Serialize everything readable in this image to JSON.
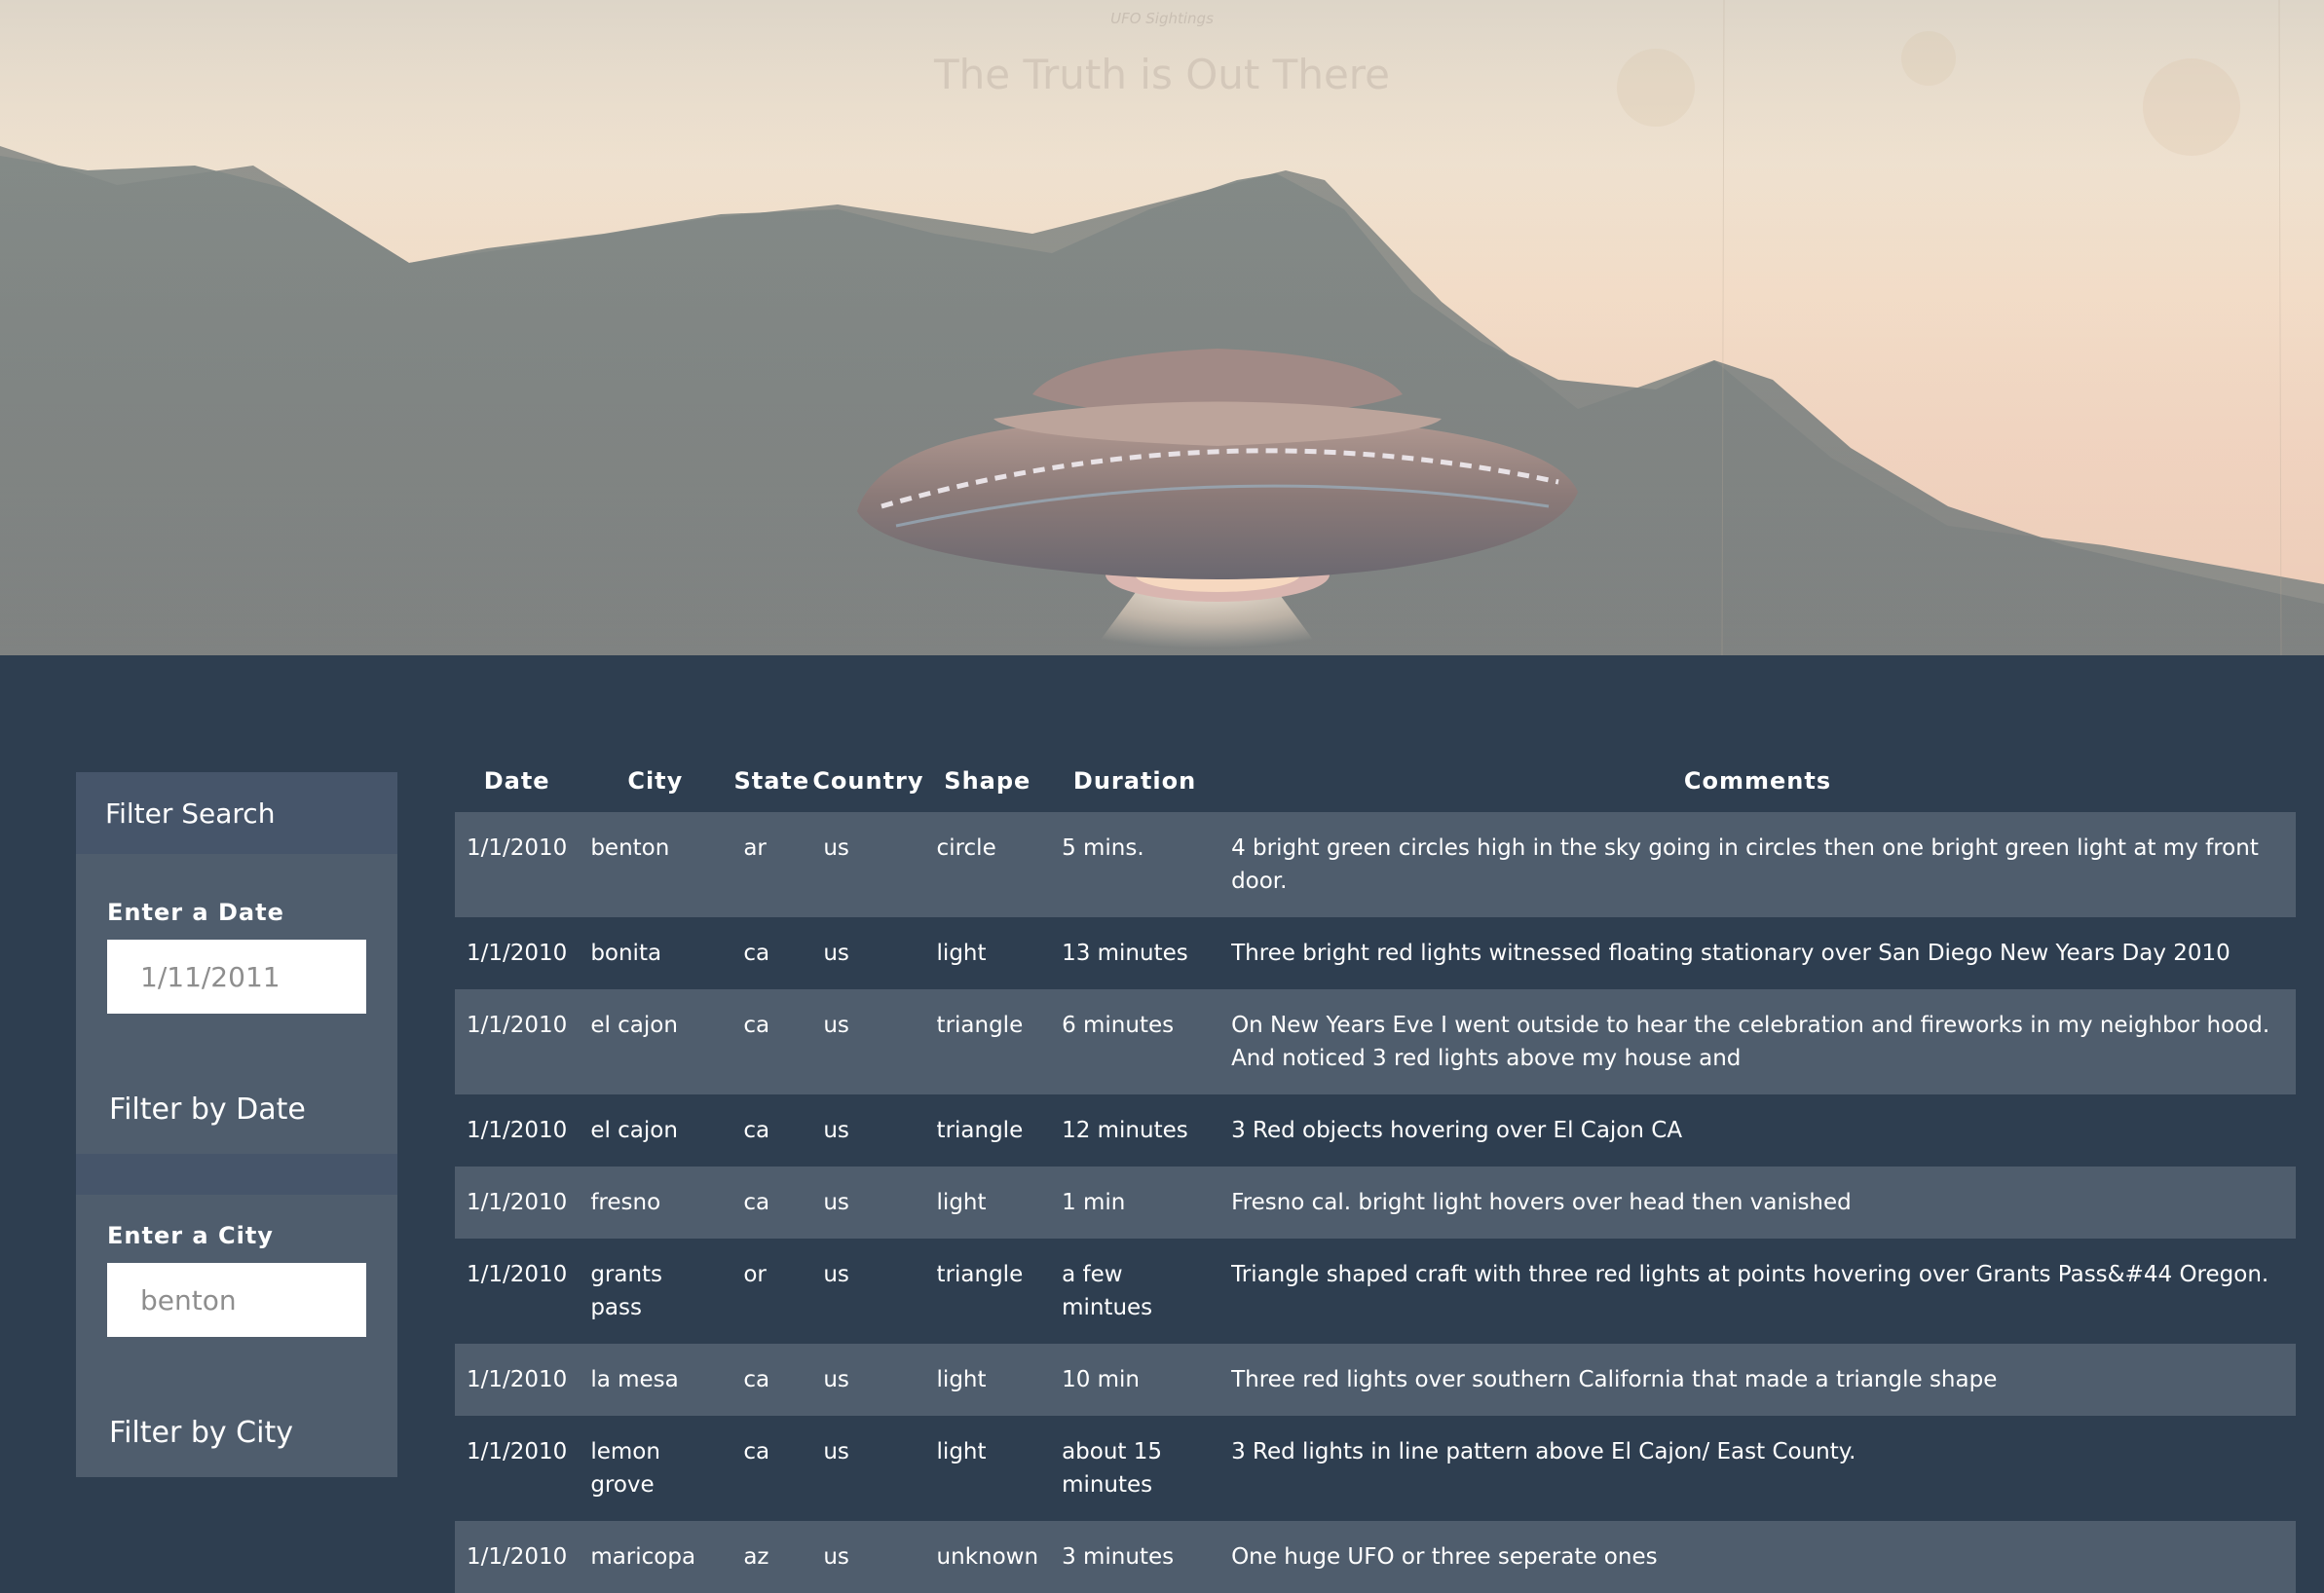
{
  "nav": {
    "brand": "UFO Sightings"
  },
  "hero": {
    "title": "The Truth is Out There"
  },
  "sidebar": {
    "panel_title": "Filter Search",
    "date": {
      "label": "Enter a Date",
      "placeholder": "1/11/2011",
      "button": "Filter by Date"
    },
    "city": {
      "label": "Enter a City",
      "placeholder": "benton",
      "button": "Filter by City"
    }
  },
  "table": {
    "headers": [
      "Date",
      "City",
      "State",
      "Country",
      "Shape",
      "Duration",
      "Comments"
    ],
    "rows": [
      [
        "1/1/2010",
        "benton",
        "ar",
        "us",
        "circle",
        "5 mins.",
        "4 bright green circles high in the sky going in circles then one bright green light at my front door."
      ],
      [
        "1/1/2010",
        "bonita",
        "ca",
        "us",
        "light",
        "13 minutes",
        "Three bright red lights witnessed floating stationary over San Diego New Years Day 2010"
      ],
      [
        "1/1/2010",
        "el cajon",
        "ca",
        "us",
        "triangle",
        "6 minutes",
        "On New Years Eve I went outside to hear the celebration and fireworks in my neighbor hood. And noticed 3 red lights above my house and"
      ],
      [
        "1/1/2010",
        "el cajon",
        "ca",
        "us",
        "triangle",
        "12 minutes",
        "3 Red objects hovering over El Cajon CA"
      ],
      [
        "1/1/2010",
        "fresno",
        "ca",
        "us",
        "light",
        "1 min",
        "Fresno cal. bright light hovers over head then vanished"
      ],
      [
        "1/1/2010",
        "grants pass",
        "or",
        "us",
        "triangle",
        "a few mintues",
        "Triangle shaped craft with three red lights at points hovering over Grants Pass&#44 Oregon."
      ],
      [
        "1/1/2010",
        "la mesa",
        "ca",
        "us",
        "light",
        "10 min",
        "Three red lights over southern California that made a triangle shape"
      ],
      [
        "1/1/2010",
        "lemon grove",
        "ca",
        "us",
        "light",
        "about 15 minutes",
        "3 Red lights in line pattern above El Cajon/ East County."
      ],
      [
        "1/1/2010",
        "maricopa",
        "az",
        "us",
        "unknown",
        "3 minutes",
        "One huge UFO or three seperate ones"
      ]
    ]
  }
}
